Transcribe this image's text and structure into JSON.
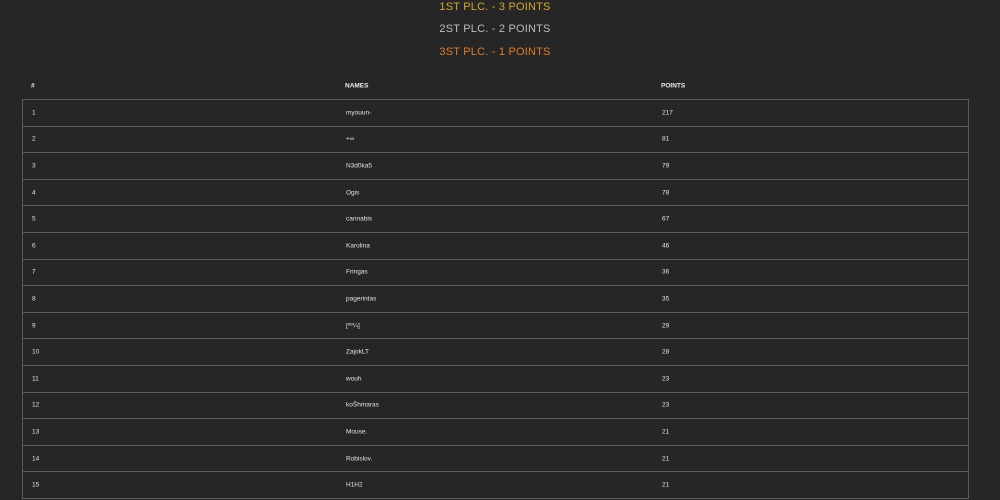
{
  "awards": {
    "first": "1ST PLC. - 3 POINTS",
    "second": "2ST PLC. - 2 POINTS",
    "third": "3ST PLC. - 1 POINTS",
    "colors": {
      "first": "#d4a92c",
      "second": "#bdbdbd",
      "third": "#e07c2a"
    }
  },
  "table": {
    "headers": {
      "rank": "#",
      "name": "NAMES",
      "points": "POINTS"
    },
    "rows": [
      {
        "rank": "1",
        "name": "myouun-",
        "points": "217"
      },
      {
        "rank": "2",
        "name": "+∞",
        "points": "81"
      },
      {
        "rank": "3",
        "name": "N3d0ka5",
        "points": "79"
      },
      {
        "rank": "4",
        "name": "Ogis",
        "points": "78"
      },
      {
        "rank": "5",
        "name": "cannabis",
        "points": "67"
      },
      {
        "rank": "6",
        "name": "Karolina",
        "points": "46"
      },
      {
        "rank": "7",
        "name": "Fringas",
        "points": "36"
      },
      {
        "rank": "8",
        "name": "pagerintas",
        "points": "35"
      },
      {
        "rank": "9",
        "name": "[ºº¼]",
        "points": "29"
      },
      {
        "rank": "10",
        "name": "ZajokLT",
        "points": "28"
      },
      {
        "rank": "11",
        "name": "wouh",
        "points": "23"
      },
      {
        "rank": "12",
        "name": "koŠhmaras",
        "points": "23"
      },
      {
        "rank": "13",
        "name": "Mouse.",
        "points": "21"
      },
      {
        "rank": "14",
        "name": "Robislov.",
        "points": "21"
      },
      {
        "rank": "15",
        "name": "H1H2",
        "points": "21"
      }
    ]
  }
}
